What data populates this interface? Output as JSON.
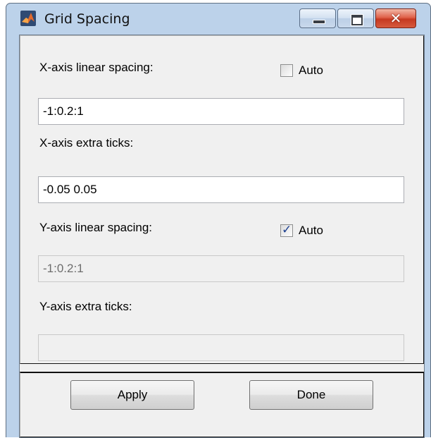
{
  "window": {
    "title": "Grid Spacing",
    "icons": {
      "app": "matlab-logo-icon",
      "minimize": "minimize-icon",
      "maximize": "maximize-icon",
      "close": "close-icon"
    },
    "close_glyph": "✕"
  },
  "x_axis": {
    "spacing_label": "X-axis linear spacing:",
    "auto_label": "Auto",
    "auto_checked": false,
    "spacing_value": "-1:0.2:1",
    "extra_ticks_label": "X-axis extra ticks:",
    "extra_ticks_value": "-0.05 0.05"
  },
  "y_axis": {
    "spacing_label": "Y-axis linear spacing:",
    "auto_label": "Auto",
    "auto_checked": true,
    "spacing_value": "-1:0.2:1",
    "extra_ticks_label": "Y-axis extra ticks:",
    "extra_ticks_value": ""
  },
  "buttons": {
    "apply": "Apply",
    "done": "Done"
  },
  "colors": {
    "accent_logo": "#e3692b",
    "close_button": "#c63a21",
    "check_mark": "#1d3f8f"
  }
}
